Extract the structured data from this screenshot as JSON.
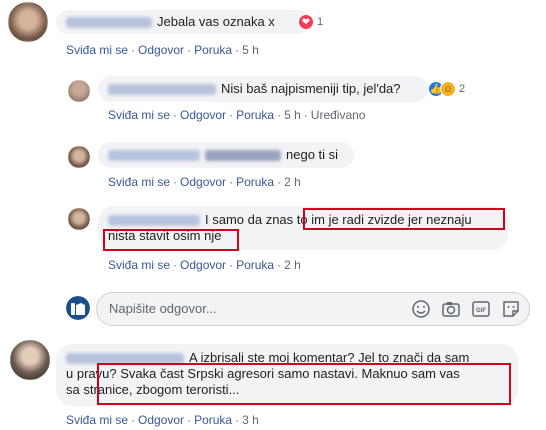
{
  "actions": {
    "like": "Sviđa mi se",
    "reply": "Odgovor",
    "message": "Poruka",
    "sep": "·"
  },
  "comments": [
    {
      "text": "Jebala vas oznaka x",
      "time": "5 h",
      "reaction_count": "1"
    },
    {
      "text": "Nisi baš najpismeniji tip, jel'da?",
      "time": "5 h",
      "edited": "Uređivano",
      "reaction_count": "2"
    },
    {
      "text": "nego ti si",
      "time": "2 h"
    },
    {
      "text_line1_a": "I samo da znas ",
      "text_line1_b": "to im je radi zvizde jer neznaju",
      "text_line2": "nista stavit osim nje",
      "time": "2 h"
    }
  ],
  "reply_input": {
    "placeholder": "Napišite odgovor..."
  },
  "bottom_comment": {
    "line1": "A izbrisali ste moj komentar? Jel to znači da sam",
    "line2_a": "u pravu? ",
    "line2_b": "Svaka čast Srpski agresori samo nastavi. Maknuo sam vas",
    "line3": "sa stranice, zbogom teroristi...",
    "time": "3 h"
  },
  "colors": {
    "link": "#385898",
    "highlight_box": "#d0021b",
    "bubble": "#f2f3f5"
  },
  "icons": [
    "love-reaction-icon",
    "like-reaction-icon",
    "haha-reaction-icon",
    "camera-icon",
    "gif-icon",
    "sticker-icon",
    "emoji-icon"
  ]
}
